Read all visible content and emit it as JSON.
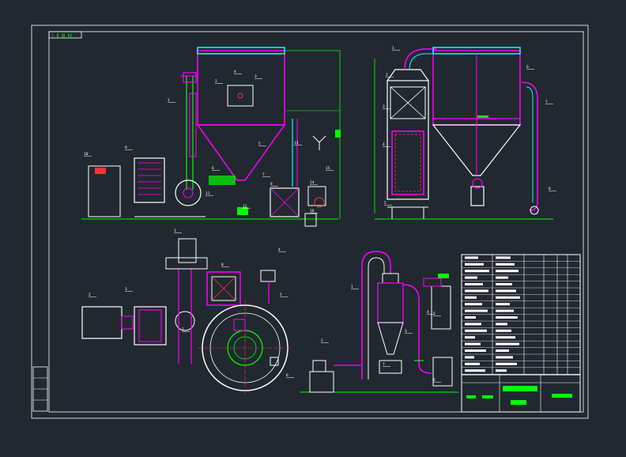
{
  "drawing": {
    "stamp": "Ⅰ Ⅱ Ⅲ Ⅳ",
    "background": "#212830",
    "colors": {
      "frame": "#ffffff",
      "equipment": "#ff00ff",
      "outline": "#ffffff",
      "cyan": "#00ffff",
      "green": "#00ff00",
      "red": "#ff3333",
      "yellow": "#ffff00",
      "blue": "#3a5bff"
    },
    "callouts": {
      "front_view": [
        "1",
        "2",
        "3",
        "4",
        "5",
        "6",
        "7",
        "8",
        "9",
        "10",
        "11",
        "12",
        "13",
        "14",
        "15",
        "16"
      ],
      "side_view": [
        "1",
        "2",
        "3",
        "4",
        "5",
        "6",
        "7",
        "8"
      ],
      "plan_view": [
        "1",
        "2",
        "3",
        "4",
        "5",
        "6",
        "7",
        "8"
      ],
      "cyclone_view": [
        "1",
        "2",
        "3",
        "4",
        "5",
        "6",
        "7"
      ]
    }
  }
}
